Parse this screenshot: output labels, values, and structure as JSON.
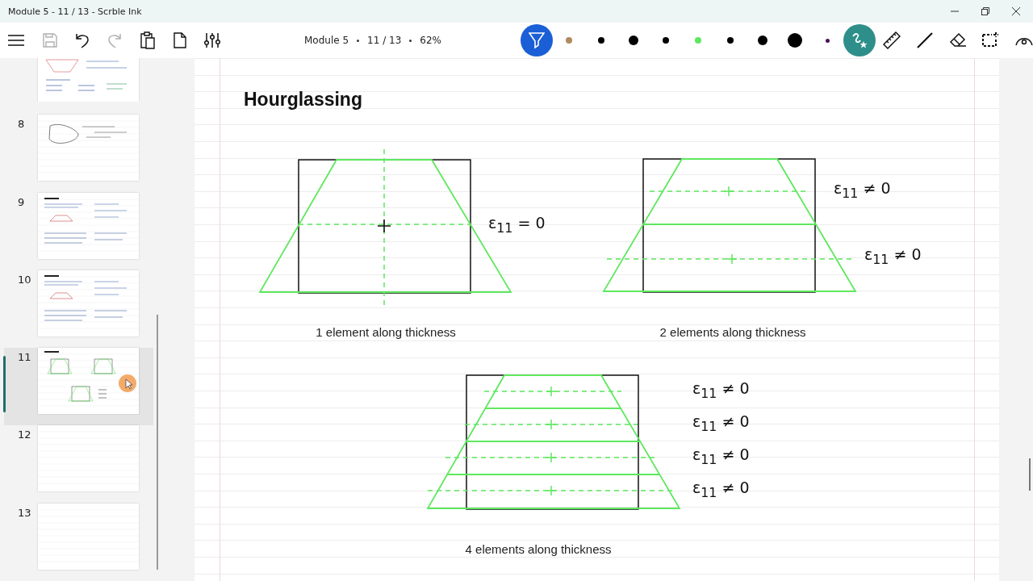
{
  "window": {
    "title": "Module 5 - 11 / 13 - Scrble Ink"
  },
  "toolbar": {
    "left_tools": [
      {
        "kind": "menu",
        "disabled": false
      },
      {
        "kind": "save",
        "disabled": true
      },
      {
        "kind": "undo",
        "disabled": false
      },
      {
        "kind": "redo",
        "disabled": true
      },
      {
        "kind": "paste",
        "disabled": false
      },
      {
        "kind": "page",
        "disabled": false
      },
      {
        "kind": "sliders",
        "disabled": false
      }
    ],
    "info": [
      "Module 5",
      "11 / 13",
      "62%"
    ],
    "pen_button": {
      "selected": true
    },
    "pens": [
      {
        "color": "#b08a60"
      },
      {
        "color": "#000000"
      },
      {
        "color": "#000000"
      },
      {
        "color": "#000000"
      },
      {
        "color": "#5ee85e"
      },
      {
        "color": "#000000"
      },
      {
        "color": "#000000"
      },
      {
        "color": "#000000"
      },
      {
        "color": "#4a1060"
      }
    ],
    "shape_button": {
      "selected": true
    },
    "right_tools": [
      {
        "kind": "ruler"
      },
      {
        "kind": "line"
      },
      {
        "kind": "eraser"
      },
      {
        "kind": "select"
      },
      {
        "kind": "view"
      }
    ]
  },
  "sidebar": {
    "pages": [
      {
        "number": "8",
        "selected": false,
        "kind": "sketch"
      },
      {
        "number": "9",
        "selected": false,
        "kind": "notes"
      },
      {
        "number": "10",
        "selected": false,
        "kind": "notes"
      },
      {
        "number": "11",
        "selected": true,
        "kind": "diagram"
      },
      {
        "number": "12",
        "selected": false,
        "kind": "blank"
      },
      {
        "number": "13",
        "selected": false,
        "kind": "blank"
      }
    ]
  },
  "page": {
    "title": "Hourglassing",
    "labels": [
      "ε$_{11}$ = 0",
      "ε$_{11}$ ≠ 0",
      "ε$_{11}$ ≠ 0",
      "ε$_{11}$ ≠ 0",
      "ε$_{11}$ ≠ 0",
      "ε$_{11}$ ≠ 0",
      "ε$_{11}$ ≠ 0"
    ],
    "captions": [
      "1 element along thickness",
      "2 elements along thickness",
      "4 elements along thickness"
    ]
  }
}
